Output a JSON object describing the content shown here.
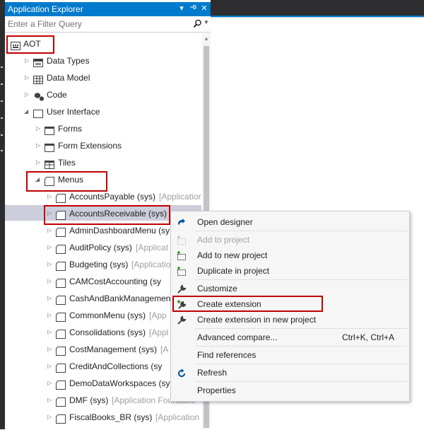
{
  "panel": {
    "title": "Application Explorer",
    "filter_placeholder": "Enter a Filter Query"
  },
  "tree": {
    "root": {
      "label": "AOT"
    },
    "items": [
      {
        "label": "Data Types",
        "icon": "datatypes-icon"
      },
      {
        "label": "Data Model",
        "icon": "table-icon"
      },
      {
        "label": "Code",
        "icon": "code-icon"
      },
      {
        "label": "User Interface",
        "icon": "folder-icon"
      },
      {
        "label": "Forms",
        "icon": "form-icon"
      },
      {
        "label": "Form Extensions",
        "icon": "form-icon"
      },
      {
        "label": "Tiles",
        "icon": "tiles-icon"
      },
      {
        "label": "Menus",
        "icon": "folder-icon"
      }
    ],
    "menus": [
      {
        "name": "AccountsPayable (sys)",
        "model": "[Application"
      },
      {
        "name": "AccountsReceivable (sys)",
        "model": ""
      },
      {
        "name": "AdminDashboardMenu (sy",
        "model": ""
      },
      {
        "name": "AuditPolicy (sys)",
        "model": "[Applicat"
      },
      {
        "name": "Budgeting (sys)",
        "model": "[Applicatio"
      },
      {
        "name": "CAMCostAccounting (sy",
        "model": ""
      },
      {
        "name": "CashAndBankManagement",
        "model": ""
      },
      {
        "name": "CommonMenu (sys)",
        "model": "[App"
      },
      {
        "name": "Consolidations (sys)",
        "model": "[Appl"
      },
      {
        "name": "CostManagement (sys)",
        "model": "[A"
      },
      {
        "name": "CreditAndCollections (sy",
        "model": ""
      },
      {
        "name": "DemoDataWorkspaces (sys",
        "model": ""
      },
      {
        "name": "DMF (sys)",
        "model": "[Application Foundatio"
      },
      {
        "name": "FiscalBooks_BR (sys)",
        "model": "[Application S"
      }
    ]
  },
  "context_menu": {
    "items": [
      {
        "label": "Open designer",
        "icon": "open-designer-icon",
        "shortcut": ""
      },
      {
        "label": "Add to project",
        "icon": "add-to-project-icon",
        "shortcut": "",
        "disabled": true
      },
      {
        "label": "Add to new project",
        "icon": "add-new-project-icon",
        "shortcut": ""
      },
      {
        "label": "Duplicate in project",
        "icon": "duplicate-icon",
        "shortcut": ""
      },
      {
        "label": "Customize",
        "icon": "wrench-icon",
        "shortcut": ""
      },
      {
        "label": "Create extension",
        "icon": "wrench-plus-icon",
        "shortcut": ""
      },
      {
        "label": "Create extension in new project",
        "icon": "wrench-icon",
        "shortcut": ""
      },
      {
        "label": "Advanced compare...",
        "icon": "",
        "shortcut": "Ctrl+K, Ctrl+A"
      },
      {
        "label": "Find references",
        "icon": "",
        "shortcut": ""
      },
      {
        "label": "Refresh",
        "icon": "refresh-icon",
        "shortcut": ""
      },
      {
        "label": "Properties",
        "icon": "",
        "shortcut": ""
      }
    ]
  },
  "colors": {
    "accent": "#007acc",
    "highlight": "#c00000",
    "selected_row": "#cccedb",
    "sys_text": "#a0a0a0"
  }
}
